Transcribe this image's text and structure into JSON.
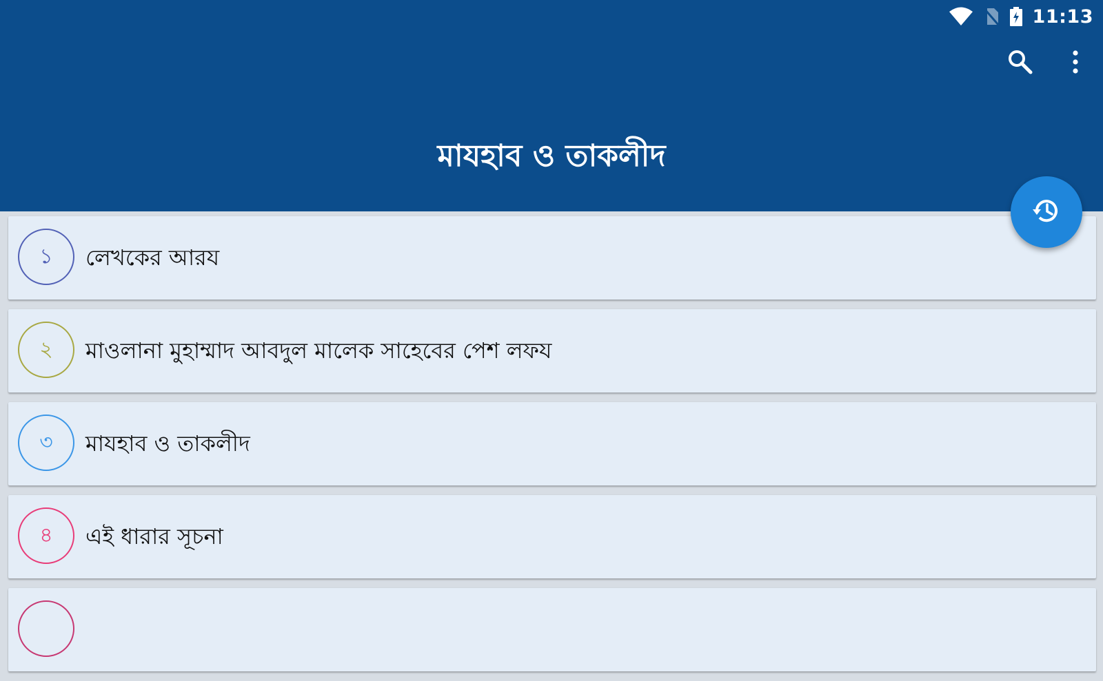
{
  "status_bar": {
    "time": "11:13",
    "icons": [
      "wifi-icon",
      "no-sim-icon",
      "battery-charging-icon"
    ]
  },
  "toolbar": {
    "title": "মাযহাব ও তাকলীদ",
    "actions": [
      "search-icon",
      "more-vert-icon"
    ]
  },
  "fab": {
    "icon": "history-icon"
  },
  "chapters": [
    {
      "number": "১",
      "title": "লেখকের আরয",
      "color": "#3949ab"
    },
    {
      "number": "২",
      "title": "মাওলানা মুহাম্মাদ আবদুল মালেক সাহেবের পেশ লফয",
      "color": "#9e9d24"
    },
    {
      "number": "৩",
      "title": "মাযহাব ও তাকলীদ",
      "color": "#1e88e5"
    },
    {
      "number": "৪",
      "title": "এই ধারার সূচনা",
      "color": "#e91e63"
    },
    {
      "number": "",
      "title": "",
      "color": "#c2185b"
    }
  ],
  "colors": {
    "app_bar": "#0c4d8c",
    "fab": "#1f86db",
    "card_bg": "#e4edf7"
  }
}
